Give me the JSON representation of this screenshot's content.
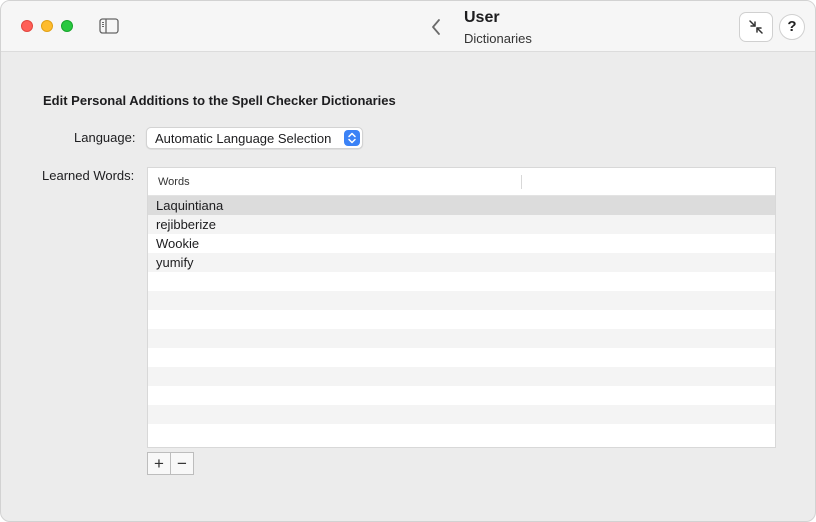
{
  "window": {
    "title": "User",
    "subtitle": "Dictionaries"
  },
  "icons": {
    "sidebar": "sidebar-icon",
    "back": "chevron-left-icon",
    "collapse": "collapse-arrows-icon",
    "help": "?"
  },
  "main": {
    "section_title": "Edit Personal Additions to the Spell Checker Dictionaries",
    "language_label": "Language:",
    "language_value": "Automatic Language Selection",
    "learned_label": "Learned Words:",
    "table": {
      "column_header": "Words",
      "words": [
        "Laquintiana",
        "rejibberize",
        "Wookie",
        "yumify"
      ],
      "selected_index": 0
    },
    "add_label": "+",
    "remove_label": "−"
  },
  "colors": {
    "accent": "#3b82f6",
    "close": "#ff5f57",
    "minimize": "#febc2e",
    "maximize": "#28c840"
  }
}
